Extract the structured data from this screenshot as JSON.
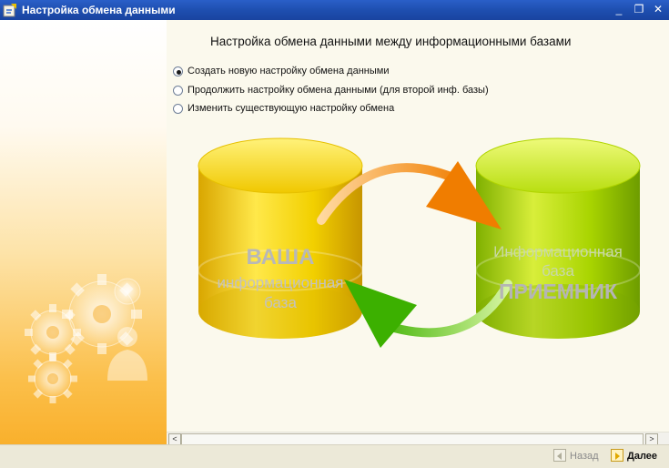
{
  "window": {
    "title": "Настройка обмена данными",
    "minimize_glyph": "_",
    "restore_glyph": "❐",
    "close_glyph": "✕"
  },
  "main": {
    "heading": "Настройка обмена данными между информационными базами",
    "options": [
      {
        "label": "Создать новую настройку обмена данными",
        "selected": true
      },
      {
        "label": "Продолжить настройку обмена данными (для второй инф. базы)",
        "selected": false
      },
      {
        "label": "Изменить существующую настройку обмена",
        "selected": false
      }
    ],
    "diagram": {
      "source_db": {
        "line1": "ВАША",
        "line2": "информационная",
        "line3": "база"
      },
      "target_db": {
        "line1": "Информационная",
        "line2": "база",
        "line3": "ПРИЕМНИК"
      }
    }
  },
  "scrollbar": {
    "left_glyph": "<",
    "right_glyph": ">"
  },
  "footer": {
    "back_label": "Назад",
    "next_label": "Далее"
  },
  "colors": {
    "titlebar": "#1e4fb0",
    "source_db": "#f2d000",
    "target_db": "#a8d400",
    "arrow_orange": "#f07d00",
    "arrow_green": "#3cb000"
  }
}
